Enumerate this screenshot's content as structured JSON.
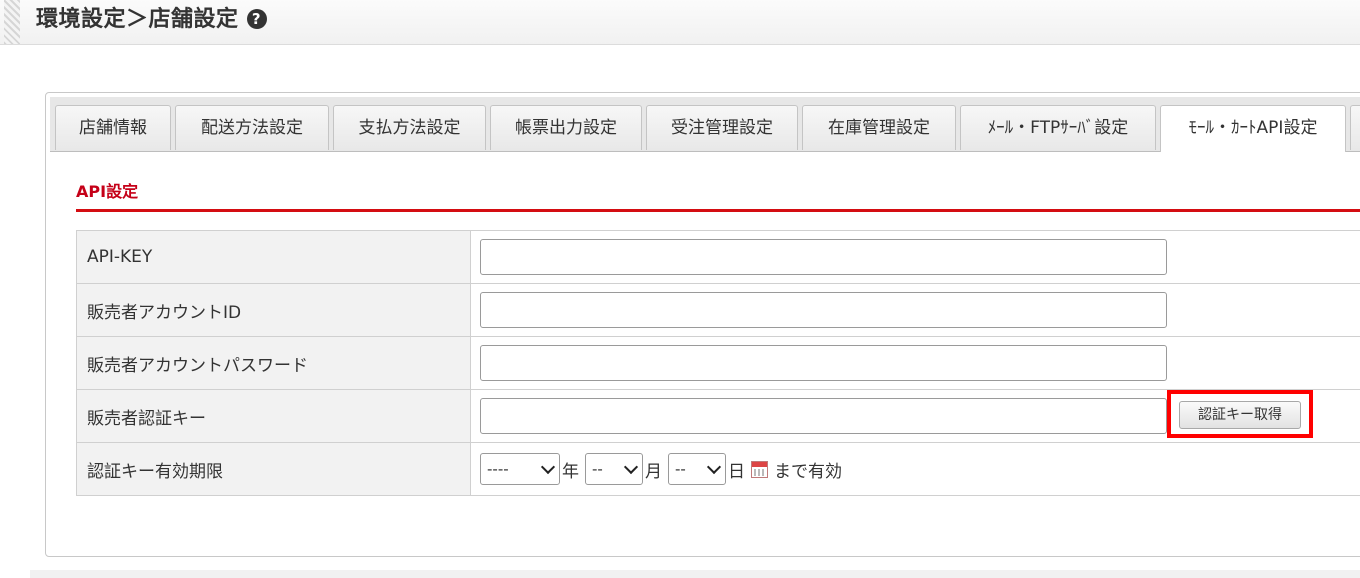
{
  "header": {
    "title": "環境設定＞店舗設定",
    "help_icon": "question-circle-icon"
  },
  "tabs": [
    {
      "label": "店舗情報",
      "active": false
    },
    {
      "label": "配送方法設定",
      "active": false
    },
    {
      "label": "支払方法設定",
      "active": false
    },
    {
      "label": "帳票出力設定",
      "active": false
    },
    {
      "label": "受注管理設定",
      "active": false
    },
    {
      "label": "在庫管理設定",
      "active": false
    },
    {
      "label": "ﾒｰﾙ・FTPｻｰﾊﾞ設定",
      "active": false
    },
    {
      "label": "ﾓｰﾙ・ｶｰﾄAPI設定",
      "active": true
    }
  ],
  "section": {
    "title": "API設定"
  },
  "form": {
    "api_key": {
      "label": "API-KEY",
      "value": ""
    },
    "seller_account_id": {
      "label": "販売者アカウントID",
      "value": ""
    },
    "seller_password": {
      "label": "販売者アカウントパスワード",
      "value": ""
    },
    "seller_auth_key": {
      "label": "販売者認証キー",
      "value": "",
      "button_label": "認証キー取得"
    },
    "expiry": {
      "label": "認証キー有効期限",
      "year_value": "----",
      "year_unit": "年",
      "month_value": "--",
      "month_unit": "月",
      "day_value": "--",
      "day_unit": "日",
      "suffix": "まで有効",
      "calendar_icon": "calendar-icon"
    }
  },
  "colors": {
    "accent_red": "#d40d12",
    "highlight_box": "#ff0000"
  }
}
